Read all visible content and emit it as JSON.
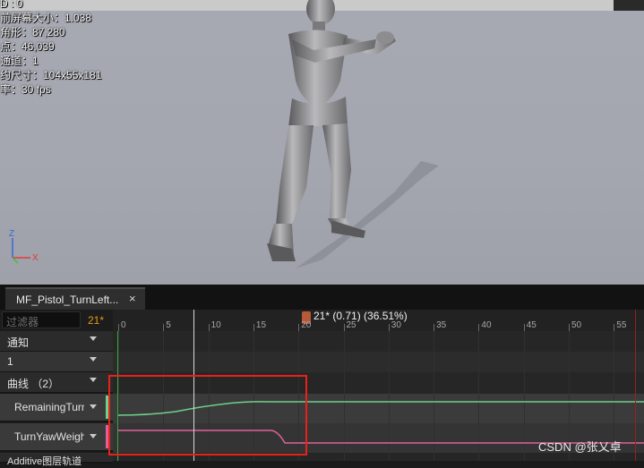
{
  "viewport": {
    "stats": [
      "D : 0",
      "前屏幕大小：1.038",
      "角形：87,280",
      "点：46,039",
      "通道：1",
      "约尺寸：104x55x181",
      "率：30 fps"
    ],
    "gizmo": {
      "z": "Z",
      "x": "X"
    },
    "background_color": "#a4a6b0"
  },
  "tab": {
    "title": "MF_Pistol_TurnLeft...",
    "close": "×"
  },
  "left_panel": {
    "filter_placeholder": "过滤器",
    "frame_count": "21*",
    "tracks": [
      {
        "label": "通知"
      },
      {
        "label": "1"
      },
      {
        "label": "曲线  （2）"
      }
    ],
    "curves": [
      {
        "label": "RemainingTurnYaw",
        "color": "#6fd08c"
      },
      {
        "label": "TurnYawWeight",
        "color": "#e0609a"
      }
    ],
    "additive_label": "Additive图层轨道"
  },
  "timeline": {
    "tick_labels": [
      "0",
      "5",
      "10",
      "15",
      "20",
      "25",
      "30",
      "35",
      "40",
      "45",
      "50",
      "55"
    ],
    "current_frame_readout": "21* (0.71) (36.51%)",
    "playhead_frame": 21
  },
  "watermark": "CSDN @张乂卓"
}
